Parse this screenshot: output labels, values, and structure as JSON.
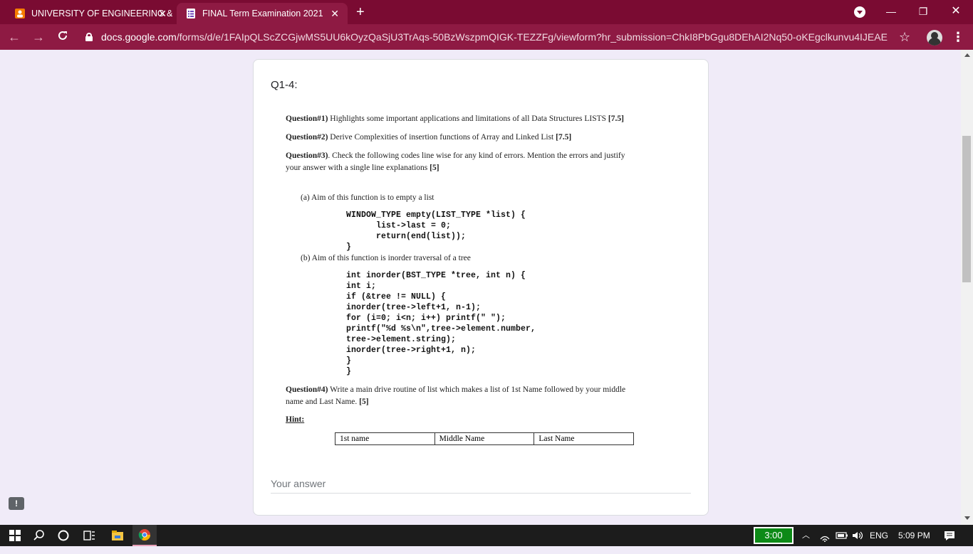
{
  "browser": {
    "tabs": [
      {
        "label": "UNIVERSITY OF ENGINEERING &",
        "close": "✕",
        "icon": "orange-person-icon"
      },
      {
        "label": "FINAL Term Examination 2021",
        "close": "✕",
        "icon": "google-forms-icon"
      }
    ],
    "new_tab": "+",
    "window": {
      "minimize": "—",
      "maximize": "❐",
      "close": "✕"
    },
    "url_host": "docs.google.com",
    "url_path": "/forms/d/e/1FAIpQLScZCGjwMS5UU6kOyzQaSjU3TrAqs-50BzWszpmQIGK-TEZZFg/viewform?hr_submission=ChkI8PbGgu8DEhAI2Nq50-oKEgclkunvu4IJEAE",
    "accent_color": "#7a0b32"
  },
  "form": {
    "question_title": "Q1-4:",
    "q1_label": "Question#1)",
    "q1_text": " Highlights some important applications and limitations of all Data Structures LISTS ",
    "q1_marks": "[7.5]",
    "q2_label": "Question#2)",
    "q2_text": " Derive Complexities of insertion functions of Array and Linked List ",
    "q2_marks": "[7.5]",
    "q3_label": "Question#3)",
    "q3_text_line1": ". Check the following codes line wise for any kind of errors. Mention the errors and justify",
    "q3_text_line2": "your answer with a single line explanations ",
    "q3_marks": "[5]",
    "part_a": "(a)  Aim of this function is to empty a list",
    "code_a": "WINDOW_TYPE empty(LIST_TYPE *list) {\n      list->last = 0;\n      return(end(list));\n}",
    "part_b": "(b)  Aim of this function is  inorder traversal of a tree",
    "code_b": "int inorder(BST_TYPE *tree, int n) {\nint i;\nif (&tree != NULL) {\ninorder(tree->left+1, n-1);\nfor (i=0; i<n; i++) printf(\" \");\nprintf(\"%d %s\\n\",tree->element.number,\ntree->element.string);\ninorder(tree->right+1, n);\n}\n}",
    "q4_label": "Question#4)",
    "q4_text_line1": " Write a main drive routine of list which makes a list of 1st Name followed by your middle",
    "q4_text_line2": "name and Last Name. ",
    "q4_marks": "[5]",
    "hint_label": "Hint:",
    "hint_columns": [
      "1st name",
      "Middle Name",
      "Last Name"
    ],
    "answer_placeholder": "Your answer",
    "feedback": "!"
  },
  "taskbar": {
    "timer": "3:00",
    "language": "ENG",
    "clock": "5:09 PM"
  }
}
